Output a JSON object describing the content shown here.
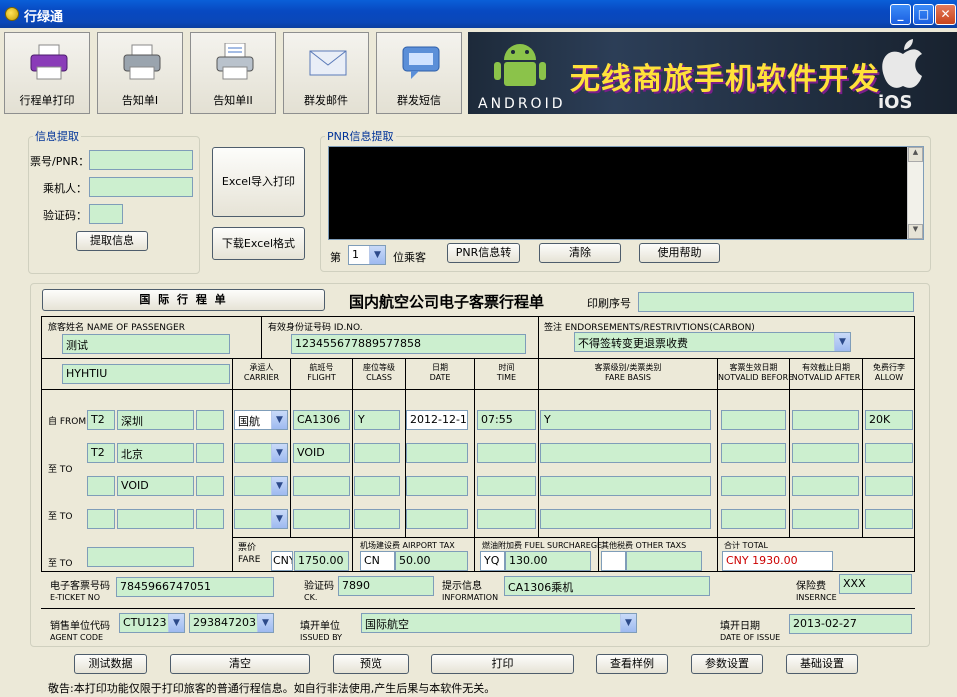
{
  "window": {
    "title": "行绿通"
  },
  "toolbar": {
    "buttons": [
      {
        "label": "行程单打印",
        "icon": "printer-purple-icon"
      },
      {
        "label": "告知单I",
        "icon": "printer-icon"
      },
      {
        "label": "告知单II",
        "icon": "printer-paper-icon"
      },
      {
        "label": "群发邮件",
        "icon": "envelope-icon"
      },
      {
        "label": "群发短信",
        "icon": "sms-icon"
      }
    ],
    "banner": {
      "text": "无线商旅手机软件开发",
      "android": "ANDROID",
      "ios": "iOS"
    }
  },
  "info": {
    "legend": "信息提取",
    "ticket_label": "票号/PNR：",
    "passenger_label": "乘机人：",
    "code_label": "验证码：",
    "extract_button": "提取信息"
  },
  "excel": {
    "import_button": "Excel导入打印",
    "download_button": "下载Excel格式"
  },
  "pnr": {
    "legend": "PNR信息提取",
    "seq_prefix": "第",
    "seq_value": "1",
    "seq_suffix": "位乘客",
    "convert_button": "PNR信息转",
    "clear_button": "清除",
    "help_button": "使用帮助"
  },
  "ticket": {
    "type_button": "国 际 行 程 单",
    "heading": "国内航空公司电子客票行程单",
    "print_no_label": "印刷序号",
    "passenger_name_label": "旅客姓名  NAME OF PASSENGER",
    "passenger_name": "测试",
    "id_label": "有效身份证号码  ID.NO.",
    "id_value": "123455677889577858",
    "endorse_label": "签注  ENDORSEMENTS/RESTRIVTIONS(CARBON)",
    "endorse_value": "不得签转变更退票收费",
    "pnr_code": "HYHTIU",
    "columns": [
      {
        "cn": "承运人",
        "en": "CARRIER"
      },
      {
        "cn": "航班号",
        "en": "FLIGHT"
      },
      {
        "cn": "座位等级",
        "en": "CLASS"
      },
      {
        "cn": "日期",
        "en": "DATE"
      },
      {
        "cn": "时间",
        "en": "TIME"
      },
      {
        "cn": "客票级别/类票类别",
        "en": "FARE BASIS"
      },
      {
        "cn": "客票生效日期",
        "en": "NOTVALID BEFORE"
      },
      {
        "cn": "有效截止日期",
        "en": "NOTVALID AFTER"
      },
      {
        "cn": "免费行李",
        "en": "ALLOW"
      }
    ],
    "row_labels": [
      "自 FROM",
      "至 TO",
      "至 TO",
      "至 TO"
    ],
    "seg1": {
      "terminal": "T2",
      "city": "深圳",
      "carrier": "国航",
      "flight": "CA1306",
      "class": "Y",
      "date": "2012-12-1:",
      "time": "07:55",
      "fare_basis": "Y",
      "allow": "20K"
    },
    "seg2": {
      "terminal": "T2",
      "city": "北京",
      "flight": "VOID"
    },
    "seg3": {
      "city": "VOID"
    },
    "fare_label_cn": "票价",
    "fare_label_en": "FARE",
    "fare_currency": "CNY",
    "fare_value": "1750.00",
    "airport_tax_label": "机场建设费  AIRPORT TAX",
    "airport_tax_code": "CN",
    "airport_tax_value": "50.00",
    "fuel_label": "燃油附加费  FUEL SURCHAREGE",
    "fuel_code": "YQ",
    "fuel_value": "130.00",
    "other_label": "其他税费  OTHER TAXS",
    "total_label": "合计  TOTAL",
    "total_value": "CNY 1930.00",
    "eticket_label_cn": "电子客票号码",
    "eticket_label_en": "E-TICKET NO",
    "eticket_value": "7845966747051",
    "ck_label_cn": "验证码",
    "ck_label_en": "CK.",
    "ck_value": "7890",
    "info_label_cn": "提示信息",
    "info_label_en": "INFORMATION",
    "info_value": "CA1306乘机",
    "insurance_label_cn": "保险费",
    "insurance_label_en": "INSERNCE",
    "insurance_value": "XXX",
    "agent_label_cn": "销售单位代码",
    "agent_label_en": "AGENT CODE",
    "agent_code": "CTU123",
    "agent_no": "293847203",
    "issued_label_cn": "填开单位",
    "issued_label_en": "ISSUED BY",
    "issued_value": "国际航空",
    "date_label_cn": "填开日期",
    "date_label_en": "DATE OF ISSUE",
    "date_value": "2013-02-27"
  },
  "actions": [
    "测试数据",
    "清空",
    "预览",
    "打印",
    "查看样例",
    "参数设置",
    "基础设置"
  ],
  "footer": "敬告:本打印功能仅限于打印旅客的普通行程信息。如自行非法使用,产生后果与本软件无关。",
  "colors": {
    "field": "#ccefcf",
    "titlebar": "#0a5fd8",
    "total": "#cc0000"
  }
}
